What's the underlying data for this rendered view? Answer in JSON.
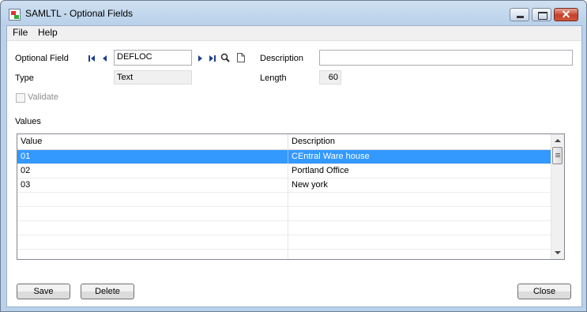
{
  "window": {
    "title": "SAMLTL - Optional Fields",
    "close_glyph": "✕"
  },
  "menu": [
    "File",
    "Help"
  ],
  "form": {
    "optional_field_label": "Optional Field",
    "optional_field_value": "DEFLOC",
    "description_label": "Description",
    "description_value": "",
    "type_label": "Type",
    "type_value": "Text",
    "length_label": "Length",
    "length_value": "60",
    "validate_label": "Validate",
    "validate_checked": false
  },
  "values_section": {
    "label": "Values",
    "columns": [
      "Value",
      "Description"
    ],
    "rows": [
      {
        "value": "01",
        "description": "CEntral Ware house",
        "selected": true
      },
      {
        "value": "02",
        "description": "Portland Office",
        "selected": false
      },
      {
        "value": "03",
        "description": "New york",
        "selected": false
      }
    ]
  },
  "buttons": {
    "save": "Save",
    "delete": "Delete",
    "close": "Close"
  },
  "icons": [
    "first-record-icon",
    "previous-record-icon",
    "next-record-icon",
    "last-record-icon",
    "search-icon",
    "new-document-icon"
  ],
  "colors": {
    "selection": "#3399ff",
    "window_frame": "#b9d1ea",
    "close_button": "#c4402a"
  }
}
